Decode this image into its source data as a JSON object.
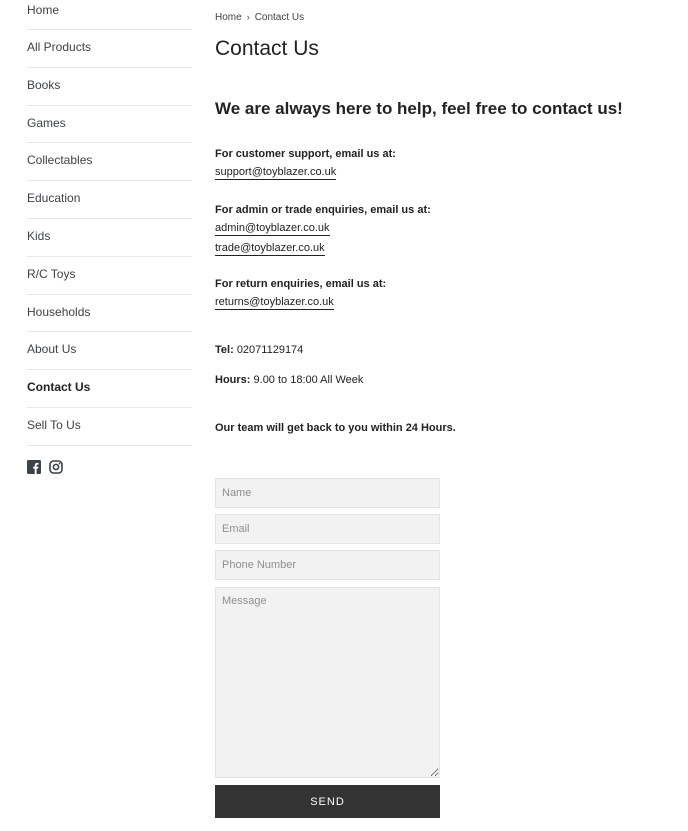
{
  "sidebar": {
    "items": [
      {
        "label": "Home"
      },
      {
        "label": "All Products"
      },
      {
        "label": "Books"
      },
      {
        "label": "Games"
      },
      {
        "label": "Collectables"
      },
      {
        "label": "Education"
      },
      {
        "label": "Kids"
      },
      {
        "label": "R/C Toys"
      },
      {
        "label": "Households"
      },
      {
        "label": "About Us"
      },
      {
        "label": "Contact Us",
        "active": true
      },
      {
        "label": "Sell To Us"
      }
    ],
    "social": [
      "facebook-icon",
      "instagram-icon"
    ]
  },
  "breadcrumb": {
    "home": "Home",
    "separator": "›",
    "current": "Contact Us"
  },
  "page": {
    "title": "Contact Us",
    "headline": "We are always here to help, feel free to contact us!"
  },
  "contact": {
    "support_label": "For customer support, email us at:",
    "support_email": "support@toyblazer.co.uk",
    "admin_label": "For admin or trade enquiries, email us at:",
    "admin_email": "admin@toyblazer.co.uk",
    "trade_email": "trade@toyblazer.co.uk",
    "returns_label": "For return enquiries, email us at:",
    "returns_email": "returns@toyblazer.co.uk",
    "tel_label": "Tel:",
    "tel_value": "02071129174",
    "hours_label": "Hours:",
    "hours_value": "9.00 to 18:00 All Week",
    "response_note": "Our team will get back to you within 24 Hours."
  },
  "form": {
    "name_placeholder": "Name",
    "email_placeholder": "Email",
    "phone_placeholder": "Phone Number",
    "message_placeholder": "Message",
    "send_label": "SEND"
  },
  "colors": {
    "text": "#3d4246",
    "field_bg": "#f2f2f2",
    "button_bg": "#333333"
  }
}
